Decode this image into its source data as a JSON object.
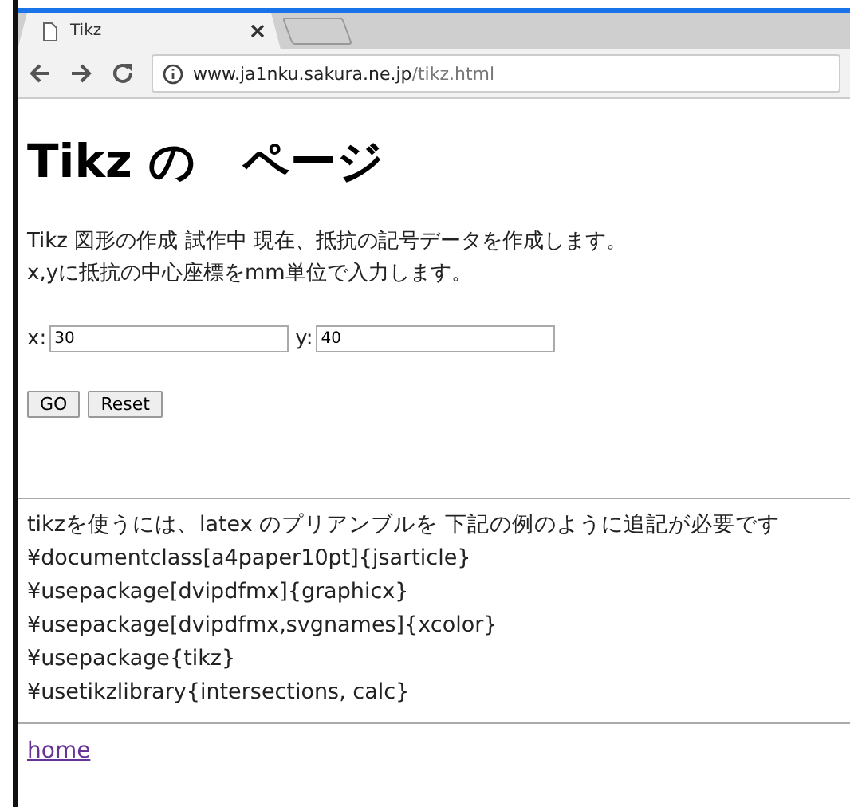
{
  "browser": {
    "tabs": [
      {
        "title": "Tikz",
        "selected": true
      }
    ],
    "address": {
      "host": "www.ja1nku.sakura.ne.jp",
      "path": "/tikz.html"
    }
  },
  "heading": "Tikz の　ページ",
  "intro": [
    "Tikz 図形の作成 試作中 現在、抵抗の記号データを作成します。",
    "x,yに抵抗の中心座標をmm単位で入力します。"
  ],
  "fields": [
    {
      "label": "x:",
      "value": "30"
    },
    {
      "label": "y:",
      "value": "40"
    }
  ],
  "buttons": [
    "GO",
    "Reset"
  ],
  "notes": [
    "tikzを使うには、latex のプリアンブルを 下記の例のように追記が必要です",
    "¥documentclass[a4paper10pt]{jsarticle}",
    "¥usepackage[dvipdfmx]{graphicx}",
    "¥usepackage[dvipdfmx,svgnames]{xcolor}",
    "¥usepackage{tikz}",
    "¥usetikzlibrary{intersections, calc}"
  ],
  "link": "home"
}
